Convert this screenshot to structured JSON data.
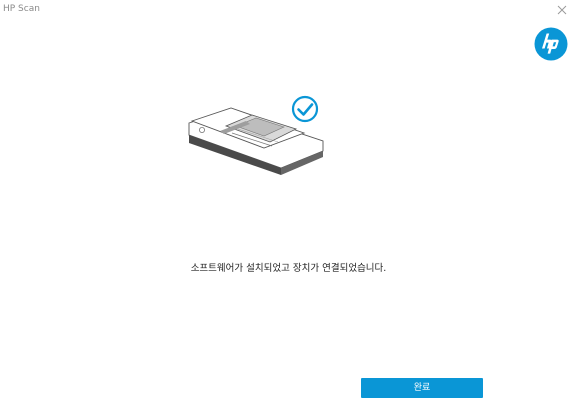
{
  "window": {
    "title": "HP Scan"
  },
  "header": {
    "logo_icon": "hp-logo-icon",
    "close_icon": "close-icon"
  },
  "main": {
    "illustration_icon": "scanner-with-checkmark-icon",
    "message": "소프트웨어가 설치되었고 장치가 연결되었습니다.",
    "done_label": "완료"
  },
  "colors": {
    "accent": "#0a96d6",
    "logo": "#0a96d6",
    "text": "#222222"
  }
}
